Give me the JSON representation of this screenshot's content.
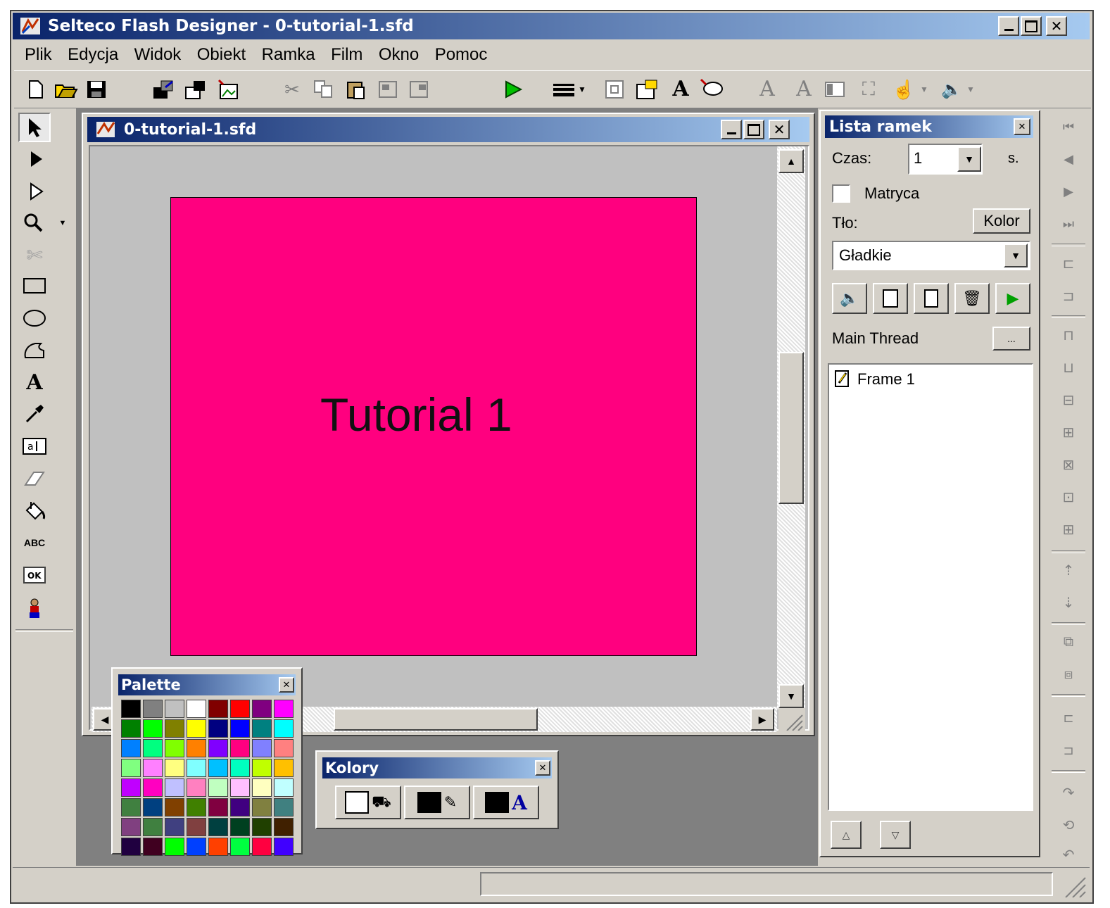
{
  "app": {
    "title": "Selteco Flash Designer - 0-tutorial-1.sfd"
  },
  "menu": [
    "Plik",
    "Edycja",
    "Widok",
    "Obiekt",
    "Ramka",
    "Film",
    "Okno",
    "Pomoc"
  ],
  "document": {
    "title": "0-tutorial-1.sfd",
    "canvas_text": "Tutorial 1",
    "canvas_color": "#ff007f"
  },
  "frames_panel": {
    "title": "Lista ramek",
    "time_label": "Czas:",
    "time_value": "1",
    "time_unit": "s.",
    "matrix_label": "Matryca",
    "background_label": "Tło:",
    "color_button": "Kolor",
    "fill_select": "Gładkie",
    "thread_label": "Main Thread",
    "thread_button": "...",
    "frames": [
      "Frame 1"
    ]
  },
  "palette": {
    "title": "Palette",
    "colors": [
      "#000000",
      "#808080",
      "#c0c0c0",
      "#ffffff",
      "#800000",
      "#ff0000",
      "#800080",
      "#ff00ff",
      "#008000",
      "#00ff00",
      "#808000",
      "#ffff00",
      "#000080",
      "#0000ff",
      "#008080",
      "#00ffff",
      "#0080ff",
      "#00ff80",
      "#80ff00",
      "#ff8000",
      "#8000ff",
      "#ff0080",
      "#8080ff",
      "#ff8080",
      "#80ff80",
      "#ff80ff",
      "#ffff80",
      "#80ffff",
      "#00c0ff",
      "#00ffc0",
      "#c0ff00",
      "#ffc000",
      "#c000ff",
      "#ff00c0",
      "#c0c0ff",
      "#ff80c0",
      "#c0ffc0",
      "#ffc0ff",
      "#ffffc0",
      "#c0ffff",
      "#408040",
      "#004080",
      "#804000",
      "#408000",
      "#800040",
      "#400080",
      "#808040",
      "#408080",
      "#804080",
      "#408040",
      "#404080",
      "#804040",
      "#004040",
      "#004020",
      "#204000",
      "#402000",
      "#200040",
      "#400020",
      "#00ff00",
      "#0040ff",
      "#ff4000",
      "#00ff40",
      "#ff0040",
      "#4000ff"
    ]
  },
  "colors_panel": {
    "title": "Kolory"
  }
}
